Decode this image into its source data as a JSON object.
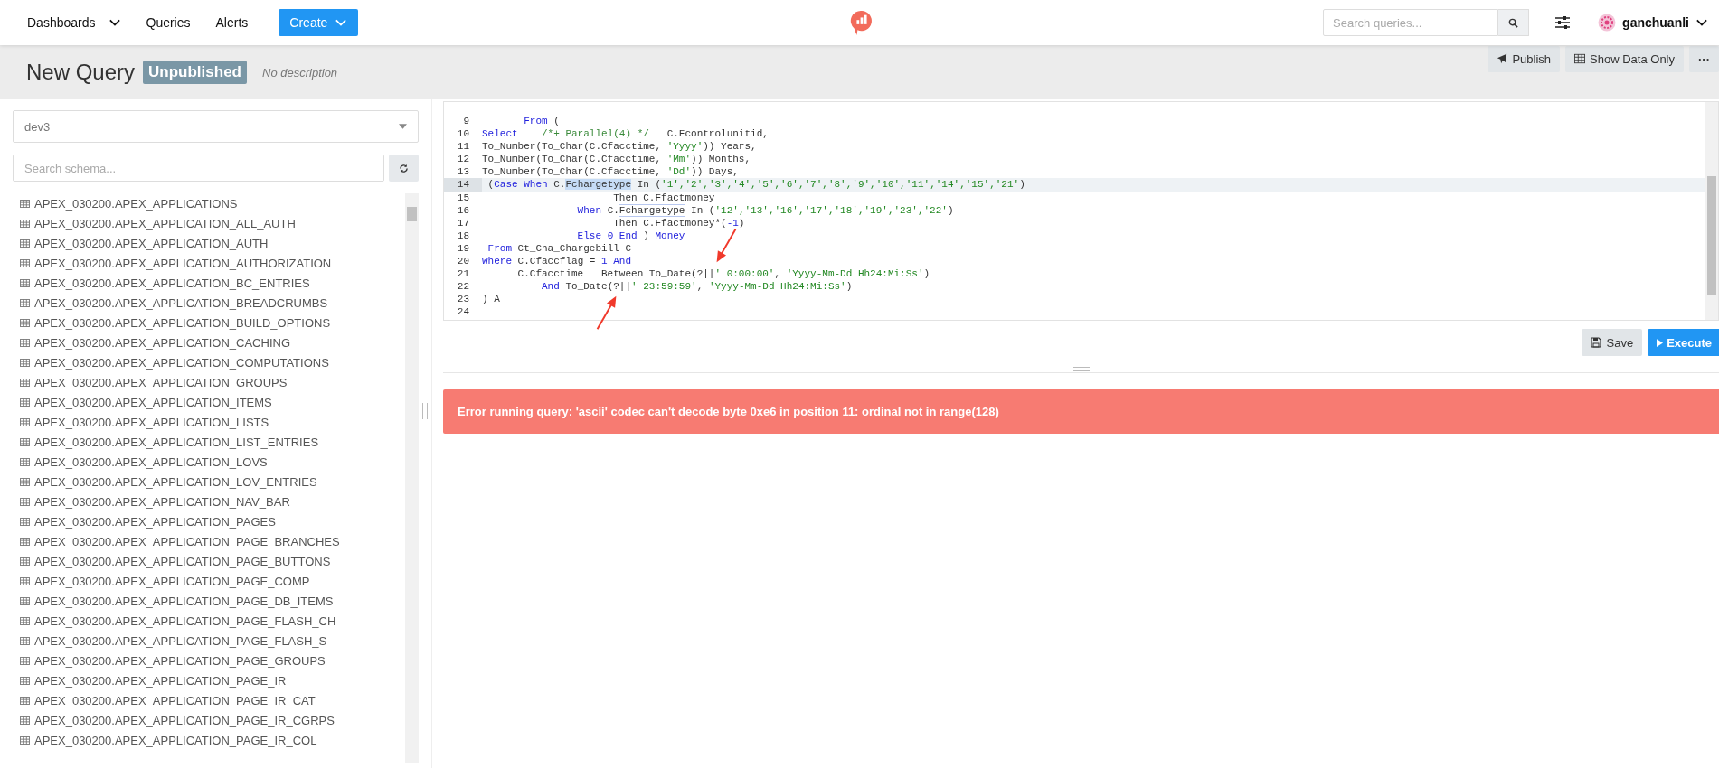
{
  "navbar": {
    "items": [
      {
        "label": "Dashboards",
        "kind": "dropdown"
      },
      {
        "label": "Queries",
        "kind": "link"
      },
      {
        "label": "Alerts",
        "kind": "link"
      }
    ],
    "create_button": "Create",
    "search": {
      "placeholder": "Search queries..."
    },
    "user": "ganchuanli"
  },
  "query_header": {
    "title": "New Query",
    "badge": "Unpublished",
    "description": "No description",
    "buttons": [
      {
        "label": "Publish",
        "kind": "publish"
      },
      {
        "label": "Show Data Only",
        "kind": "table"
      },
      {
        "label": "···",
        "kind": "more"
      }
    ]
  },
  "sidebar": {
    "data_source": "dev3",
    "search": {
      "placeholder": "Search schema..."
    },
    "tables": [
      "APEX_030200.APEX_APPLICATIONS",
      "APEX_030200.APEX_APPLICATION_ALL_AUTH",
      "APEX_030200.APEX_APPLICATION_AUTH",
      "APEX_030200.APEX_APPLICATION_AUTHORIZATION",
      "APEX_030200.APEX_APPLICATION_BC_ENTRIES",
      "APEX_030200.APEX_APPLICATION_BREADCRUMBS",
      "APEX_030200.APEX_APPLICATION_BUILD_OPTIONS",
      "APEX_030200.APEX_APPLICATION_CACHING",
      "APEX_030200.APEX_APPLICATION_COMPUTATIONS",
      "APEX_030200.APEX_APPLICATION_GROUPS",
      "APEX_030200.APEX_APPLICATION_ITEMS",
      "APEX_030200.APEX_APPLICATION_LISTS",
      "APEX_030200.APEX_APPLICATION_LIST_ENTRIES",
      "APEX_030200.APEX_APPLICATION_LOVS",
      "APEX_030200.APEX_APPLICATION_LOV_ENTRIES",
      "APEX_030200.APEX_APPLICATION_NAV_BAR",
      "APEX_030200.APEX_APPLICATION_PAGES",
      "APEX_030200.APEX_APPLICATION_PAGE_BRANCHES",
      "APEX_030200.APEX_APPLICATION_PAGE_BUTTONS",
      "APEX_030200.APEX_APPLICATION_PAGE_COMP",
      "APEX_030200.APEX_APPLICATION_PAGE_DB_ITEMS",
      "APEX_030200.APEX_APPLICATION_PAGE_FLASH_CH",
      "APEX_030200.APEX_APPLICATION_PAGE_FLASH_S",
      "APEX_030200.APEX_APPLICATION_PAGE_GROUPS",
      "APEX_030200.APEX_APPLICATION_PAGE_IR",
      "APEX_030200.APEX_APPLICATION_PAGE_IR_CAT",
      "APEX_030200.APEX_APPLICATION_PAGE_IR_CGRPS",
      "APEX_030200.APEX_APPLICATION_PAGE_IR_COL"
    ]
  },
  "editor": {
    "lines": [
      {
        "number": "9",
        "highlighted": false,
        "tokens": [
          {
            "text": "       From",
            "kind": "keyword"
          },
          {
            "text": " (",
            "kind": "plain"
          }
        ]
      },
      {
        "number": "10",
        "highlighted": false,
        "tokens": [
          {
            "text": "Select",
            "kind": "keyword"
          },
          {
            "text": "    /*+ Parallel(4) */",
            "kind": "comment"
          },
          {
            "text": "   C.Fcontrolunitid,",
            "kind": "plain"
          }
        ]
      },
      {
        "number": "11",
        "highlighted": false,
        "tokens": [
          {
            "text": "To_Number(To_Char(C.Cfacctime, ",
            "kind": "plain"
          },
          {
            "text": "'Yyyy'",
            "kind": "string"
          },
          {
            "text": ")) Years,",
            "kind": "plain"
          }
        ]
      },
      {
        "number": "12",
        "highlighted": false,
        "tokens": [
          {
            "text": "To_Number(To_Char(C.Cfacctime, ",
            "kind": "plain"
          },
          {
            "text": "'Mm'",
            "kind": "string"
          },
          {
            "text": ")) Months,",
            "kind": "plain"
          }
        ]
      },
      {
        "number": "13",
        "highlighted": false,
        "tokens": [
          {
            "text": "To_Number(To_Char(C.Cfacctime, ",
            "kind": "plain"
          },
          {
            "text": "'Dd'",
            "kind": "string"
          },
          {
            "text": ")) Days,",
            "kind": "plain"
          }
        ]
      },
      {
        "number": "14",
        "highlighted": true,
        "tokens": [
          {
            "text": " (",
            "kind": "plain"
          },
          {
            "text": "Case When",
            "kind": "keyword"
          },
          {
            "text": " C.",
            "kind": "plain"
          },
          {
            "text": "Fchargetype",
            "kind": "selection"
          },
          {
            "text": " In (",
            "kind": "plain"
          },
          {
            "text": "'1','2','3','4','5','6','7','8','9','10','11','14','15','21'",
            "kind": "string"
          },
          {
            "text": ")",
            "kind": "plain"
          }
        ]
      },
      {
        "number": "15",
        "highlighted": false,
        "tokens": [
          {
            "text": "                      Then C.Ffactmoney",
            "kind": "plain"
          }
        ]
      },
      {
        "number": "16",
        "highlighted": false,
        "tokens": [
          {
            "text": "                When",
            "kind": "keyword"
          },
          {
            "text": " C.",
            "kind": "plain"
          },
          {
            "text": "Fchargetype",
            "kind": "match"
          },
          {
            "text": " In (",
            "kind": "plain"
          },
          {
            "text": "'12','13','16','17','18','19','23','22'",
            "kind": "string"
          },
          {
            "text": ")",
            "kind": "plain"
          }
        ]
      },
      {
        "number": "17",
        "highlighted": false,
        "tokens": [
          {
            "text": "                      Then C.Ffactmoney*(",
            "kind": "plain"
          },
          {
            "text": "-1",
            "kind": "number"
          },
          {
            "text": ")",
            "kind": "plain"
          }
        ]
      },
      {
        "number": "18",
        "highlighted": false,
        "tokens": [
          {
            "text": "                Else",
            "kind": "keyword"
          },
          {
            "text": " 0",
            "kind": "number"
          },
          {
            "text": " End",
            "kind": "keyword"
          },
          {
            "text": " ) ",
            "kind": "plain"
          },
          {
            "text": "Money",
            "kind": "keyword"
          }
        ]
      },
      {
        "number": "19",
        "highlighted": false,
        "tokens": [
          {
            "text": " From",
            "kind": "keyword"
          },
          {
            "text": " Ct_Cha_Chargebill C",
            "kind": "plain"
          }
        ]
      },
      {
        "number": "20",
        "highlighted": false,
        "tokens": [
          {
            "text": "Where",
            "kind": "keyword"
          },
          {
            "text": " C.Cfaccflag = ",
            "kind": "plain"
          },
          {
            "text": "1",
            "kind": "number"
          },
          {
            "text": " And",
            "kind": "keyword"
          }
        ]
      },
      {
        "number": "21",
        "highlighted": false,
        "tokens": [
          {
            "text": "      C.Cfacctime   Between To_Date(?||",
            "kind": "plain"
          },
          {
            "text": "' 0:00:00'",
            "kind": "string"
          },
          {
            "text": ", ",
            "kind": "plain"
          },
          {
            "text": "'Yyyy-Mm-Dd Hh24:Mi:Ss'",
            "kind": "string"
          },
          {
            "text": ")",
            "kind": "plain"
          }
        ]
      },
      {
        "number": "22",
        "highlighted": false,
        "tokens": [
          {
            "text": "          And",
            "kind": "keyword"
          },
          {
            "text": " To_Date(?||",
            "kind": "plain"
          },
          {
            "text": "' 23:59:59'",
            "kind": "string"
          },
          {
            "text": ", ",
            "kind": "plain"
          },
          {
            "text": "'Yyyy-Mm-Dd Hh24:Mi:Ss'",
            "kind": "string"
          },
          {
            "text": ")",
            "kind": "plain"
          }
        ]
      },
      {
        "number": "23",
        "highlighted": false,
        "tokens": [
          {
            "text": ") A",
            "kind": "plain"
          }
        ]
      },
      {
        "number": "24",
        "highlighted": false
      }
    ],
    "annotations": [
      {
        "kind": "arrow_down_left"
      },
      {
        "kind": "arrow_up_right"
      }
    ],
    "buttons": [
      {
        "label": "Save",
        "kind": "save"
      },
      {
        "label": "Execute",
        "kind": "execute"
      }
    ]
  },
  "error": "Error running query: 'ascii' codec can't decode byte 0xe6 in position 11: ordinal not in range(128)"
}
